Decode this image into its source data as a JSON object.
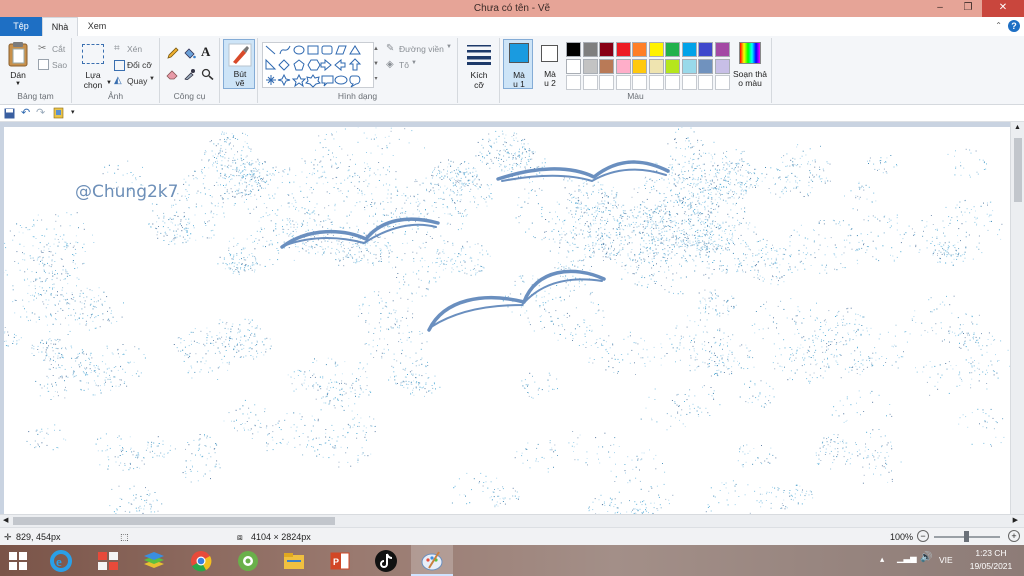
{
  "window": {
    "title": "Chưa có tên - Vẽ",
    "minimize_glyph": "–",
    "restore_glyph": "❐",
    "close_glyph": "✕"
  },
  "tabs": [
    {
      "label": "Tệp"
    },
    {
      "label": "Nhà"
    },
    {
      "label": "Xem"
    }
  ],
  "ribbon": {
    "clipboard": {
      "paste_label": "Dán",
      "cut_label": "Cắt",
      "copy_label": "Sao",
      "group_label": "Bảng tạm"
    },
    "image": {
      "select_label_1": "Lựa",
      "select_label_2": "chọn",
      "crop_label": "Xén",
      "resize_label": "Đổi cỡ",
      "rotate_label": "Quay",
      "group_label": "Ảnh"
    },
    "tools": {
      "group_label": "Công cụ"
    },
    "brushes": {
      "label_1": "Bút",
      "label_2": "vẽ"
    },
    "shapes": {
      "outline_label": "Đường viền",
      "fill_label": "Tô",
      "group_label": "Hình dạng"
    },
    "size": {
      "label_1": "Kích",
      "label_2": "cỡ"
    },
    "colors": {
      "color1_label_1": "Mà",
      "color1_label_2": "u 1",
      "color2_label_1": "Mà",
      "color2_label_2": "u 2",
      "edit_label_1": "Soạn thả",
      "edit_label_2": "o màu",
      "group_label": "Màu",
      "color1_value": "#1a9be0",
      "color2_value": "#ffffff",
      "palette_row1": [
        "#000000",
        "#7f7f7f",
        "#880015",
        "#ed1c24",
        "#ff7f27",
        "#fff200",
        "#22b14c",
        "#00a2e8",
        "#3f48cc",
        "#a349a4"
      ],
      "palette_row2": [
        "#ffffff",
        "#c3c3c3",
        "#b97a57",
        "#ffaec9",
        "#ffc90e",
        "#efe4b0",
        "#b5e61d",
        "#99d9ea",
        "#7092be",
        "#c8bfe7"
      ]
    }
  },
  "canvas": {
    "signature": "@Chung2k7",
    "stroke_color": "#6a8fbf",
    "spray_colors": [
      "#3aa0d0",
      "#6db8e0",
      "#2f7fb0",
      "#8fc8e8",
      "#4a6f9a"
    ]
  },
  "status": {
    "cursor_pos": "829, 454px",
    "canvas_size": "4104 × 2824px",
    "zoom": "100%"
  },
  "taskbar": {
    "language": "VIE",
    "time": "1:23 CH",
    "date": "19/05/2021"
  }
}
